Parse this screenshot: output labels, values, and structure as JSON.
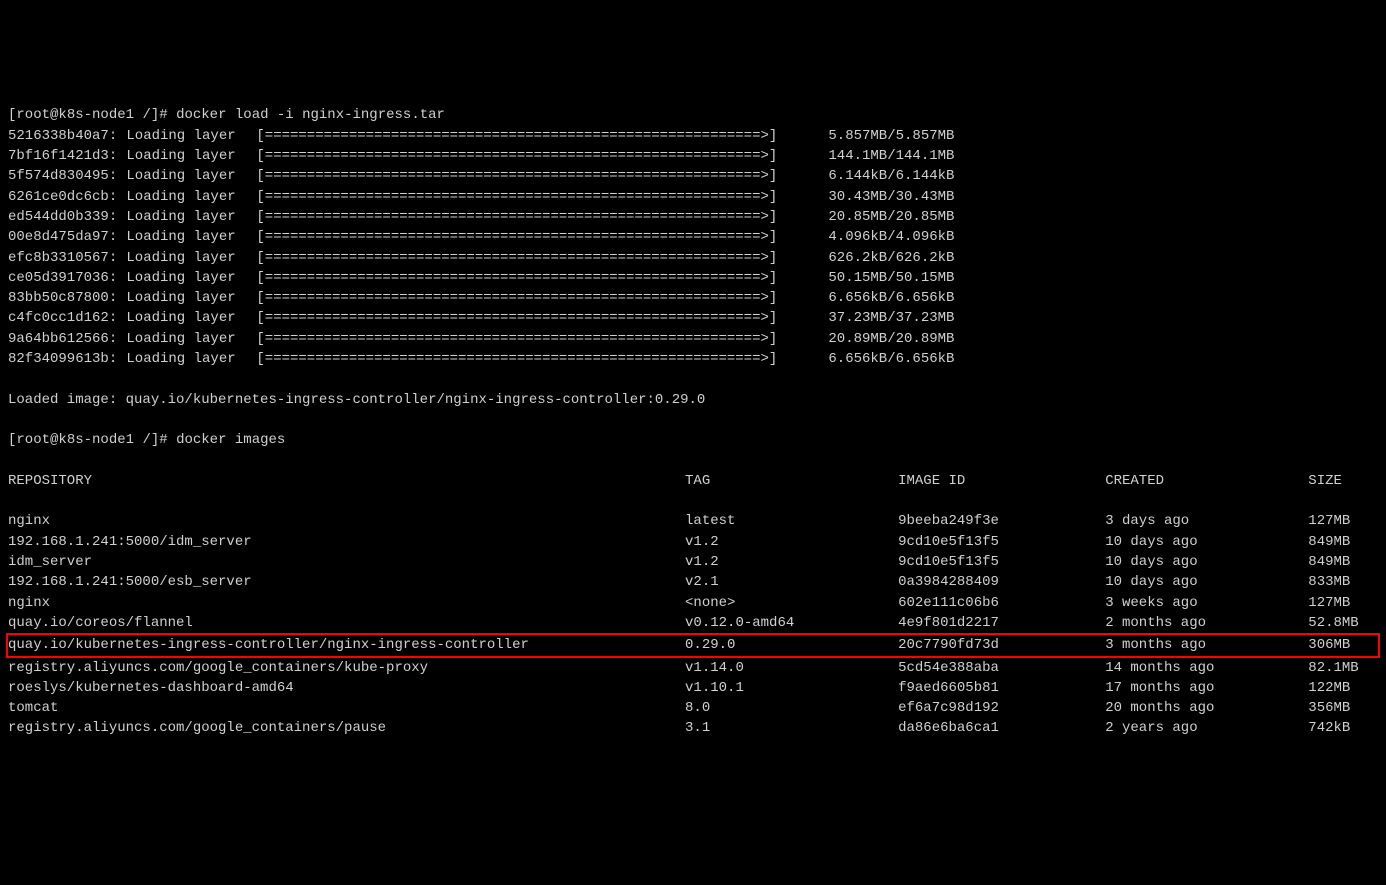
{
  "prompt1": {
    "user": "root",
    "host": "k8s-node1",
    "path": "/",
    "command": "docker load -i nginx-ingress.tar"
  },
  "layers": [
    {
      "hash": "5216338b40a7",
      "label": "Loading layer",
      "bar": "[===========================================================>]",
      "size": "5.857MB/5.857MB"
    },
    {
      "hash": "7bf16f1421d3",
      "label": "Loading layer",
      "bar": "[===========================================================>]",
      "size": "144.1MB/144.1MB"
    },
    {
      "hash": "5f574d830495",
      "label": "Loading layer",
      "bar": "[===========================================================>]",
      "size": "6.144kB/6.144kB"
    },
    {
      "hash": "6261ce0dc6cb",
      "label": "Loading layer",
      "bar": "[===========================================================>]",
      "size": "30.43MB/30.43MB"
    },
    {
      "hash": "ed544dd0b339",
      "label": "Loading layer",
      "bar": "[===========================================================>]",
      "size": "20.85MB/20.85MB"
    },
    {
      "hash": "00e8d475da97",
      "label": "Loading layer",
      "bar": "[===========================================================>]",
      "size": "4.096kB/4.096kB"
    },
    {
      "hash": "efc8b3310567",
      "label": "Loading layer",
      "bar": "[===========================================================>]",
      "size": "626.2kB/626.2kB"
    },
    {
      "hash": "ce05d3917036",
      "label": "Loading layer",
      "bar": "[===========================================================>]",
      "size": "50.15MB/50.15MB"
    },
    {
      "hash": "83bb50c87800",
      "label": "Loading layer",
      "bar": "[===========================================================>]",
      "size": "6.656kB/6.656kB"
    },
    {
      "hash": "c4fc0cc1d162",
      "label": "Loading layer",
      "bar": "[===========================================================>]",
      "size": "37.23MB/37.23MB"
    },
    {
      "hash": "9a64bb612566",
      "label": "Loading layer",
      "bar": "[===========================================================>]",
      "size": "20.89MB/20.89MB"
    },
    {
      "hash": "82f34099613b",
      "label": "Loading layer",
      "bar": "[===========================================================>]",
      "size": "6.656kB/6.656kB"
    }
  ],
  "loaded_image": "Loaded image: quay.io/kubernetes-ingress-controller/nginx-ingress-controller:0.29.0",
  "prompt2": {
    "user": "root",
    "host": "k8s-node1",
    "path": "/",
    "command": "docker images"
  },
  "images_header": {
    "repo": "REPOSITORY",
    "tag": "TAG",
    "id": "IMAGE ID",
    "created": "CREATED",
    "size": "SIZE"
  },
  "images": [
    {
      "repo": "nginx",
      "tag": "latest",
      "id": "9beeba249f3e",
      "created": "3 days ago",
      "size": "127MB",
      "highlight": false
    },
    {
      "repo": "192.168.1.241:5000/idm_server",
      "tag": "v1.2",
      "id": "9cd10e5f13f5",
      "created": "10 days ago",
      "size": "849MB",
      "highlight": false
    },
    {
      "repo": "idm_server",
      "tag": "v1.2",
      "id": "9cd10e5f13f5",
      "created": "10 days ago",
      "size": "849MB",
      "highlight": false
    },
    {
      "repo": "192.168.1.241:5000/esb_server",
      "tag": "v2.1",
      "id": "0a3984288409",
      "created": "10 days ago",
      "size": "833MB",
      "highlight": false
    },
    {
      "repo": "nginx",
      "tag": "<none>",
      "id": "602e111c06b6",
      "created": "3 weeks ago",
      "size": "127MB",
      "highlight": false
    },
    {
      "repo": "quay.io/coreos/flannel",
      "tag": "v0.12.0-amd64",
      "id": "4e9f801d2217",
      "created": "2 months ago",
      "size": "52.8MB",
      "highlight": false
    },
    {
      "repo": "quay.io/kubernetes-ingress-controller/nginx-ingress-controller",
      "tag": "0.29.0",
      "id": "20c7790fd73d",
      "created": "3 months ago",
      "size": "306MB",
      "highlight": true
    },
    {
      "repo": "registry.aliyuncs.com/google_containers/kube-proxy",
      "tag": "v1.14.0",
      "id": "5cd54e388aba",
      "created": "14 months ago",
      "size": "82.1MB",
      "highlight": false
    },
    {
      "repo": "roeslys/kubernetes-dashboard-amd64",
      "tag": "v1.10.1",
      "id": "f9aed6605b81",
      "created": "17 months ago",
      "size": "122MB",
      "highlight": false
    },
    {
      "repo": "tomcat",
      "tag": "8.0",
      "id": "ef6a7c98d192",
      "created": "20 months ago",
      "size": "356MB",
      "highlight": false
    },
    {
      "repo": "registry.aliyuncs.com/google_containers/pause",
      "tag": "3.1",
      "id": "da86e6ba6ca1",
      "created": "2 years ago",
      "size": "742kB",
      "highlight": false
    }
  ]
}
